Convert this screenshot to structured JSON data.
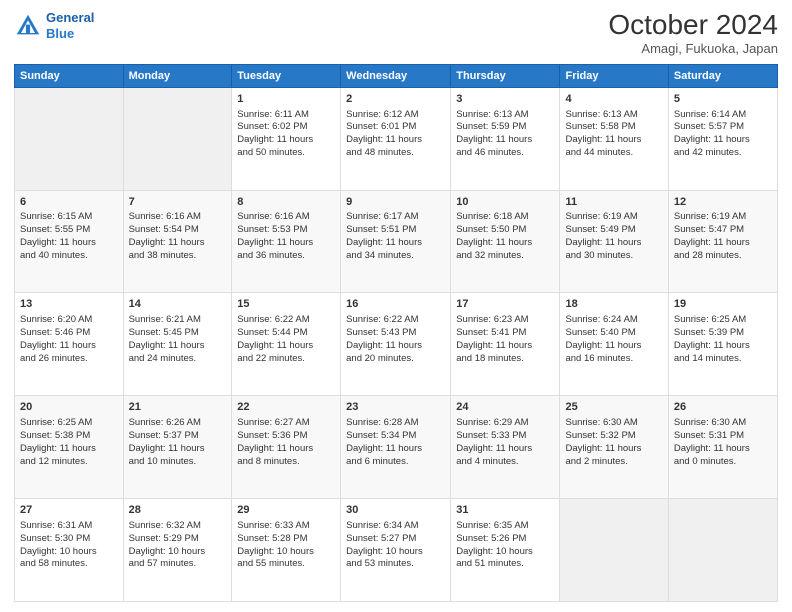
{
  "logo": {
    "line1": "General",
    "line2": "Blue"
  },
  "header": {
    "title": "October 2024",
    "subtitle": "Amagi, Fukuoka, Japan"
  },
  "days_of_week": [
    "Sunday",
    "Monday",
    "Tuesday",
    "Wednesday",
    "Thursday",
    "Friday",
    "Saturday"
  ],
  "weeks": [
    [
      {
        "day": "",
        "text": ""
      },
      {
        "day": "",
        "text": ""
      },
      {
        "day": "1",
        "text": "Sunrise: 6:11 AM\nSunset: 6:02 PM\nDaylight: 11 hours\nand 50 minutes."
      },
      {
        "day": "2",
        "text": "Sunrise: 6:12 AM\nSunset: 6:01 PM\nDaylight: 11 hours\nand 48 minutes."
      },
      {
        "day": "3",
        "text": "Sunrise: 6:13 AM\nSunset: 5:59 PM\nDaylight: 11 hours\nand 46 minutes."
      },
      {
        "day": "4",
        "text": "Sunrise: 6:13 AM\nSunset: 5:58 PM\nDaylight: 11 hours\nand 44 minutes."
      },
      {
        "day": "5",
        "text": "Sunrise: 6:14 AM\nSunset: 5:57 PM\nDaylight: 11 hours\nand 42 minutes."
      }
    ],
    [
      {
        "day": "6",
        "text": "Sunrise: 6:15 AM\nSunset: 5:55 PM\nDaylight: 11 hours\nand 40 minutes."
      },
      {
        "day": "7",
        "text": "Sunrise: 6:16 AM\nSunset: 5:54 PM\nDaylight: 11 hours\nand 38 minutes."
      },
      {
        "day": "8",
        "text": "Sunrise: 6:16 AM\nSunset: 5:53 PM\nDaylight: 11 hours\nand 36 minutes."
      },
      {
        "day": "9",
        "text": "Sunrise: 6:17 AM\nSunset: 5:51 PM\nDaylight: 11 hours\nand 34 minutes."
      },
      {
        "day": "10",
        "text": "Sunrise: 6:18 AM\nSunset: 5:50 PM\nDaylight: 11 hours\nand 32 minutes."
      },
      {
        "day": "11",
        "text": "Sunrise: 6:19 AM\nSunset: 5:49 PM\nDaylight: 11 hours\nand 30 minutes."
      },
      {
        "day": "12",
        "text": "Sunrise: 6:19 AM\nSunset: 5:47 PM\nDaylight: 11 hours\nand 28 minutes."
      }
    ],
    [
      {
        "day": "13",
        "text": "Sunrise: 6:20 AM\nSunset: 5:46 PM\nDaylight: 11 hours\nand 26 minutes."
      },
      {
        "day": "14",
        "text": "Sunrise: 6:21 AM\nSunset: 5:45 PM\nDaylight: 11 hours\nand 24 minutes."
      },
      {
        "day": "15",
        "text": "Sunrise: 6:22 AM\nSunset: 5:44 PM\nDaylight: 11 hours\nand 22 minutes."
      },
      {
        "day": "16",
        "text": "Sunrise: 6:22 AM\nSunset: 5:43 PM\nDaylight: 11 hours\nand 20 minutes."
      },
      {
        "day": "17",
        "text": "Sunrise: 6:23 AM\nSunset: 5:41 PM\nDaylight: 11 hours\nand 18 minutes."
      },
      {
        "day": "18",
        "text": "Sunrise: 6:24 AM\nSunset: 5:40 PM\nDaylight: 11 hours\nand 16 minutes."
      },
      {
        "day": "19",
        "text": "Sunrise: 6:25 AM\nSunset: 5:39 PM\nDaylight: 11 hours\nand 14 minutes."
      }
    ],
    [
      {
        "day": "20",
        "text": "Sunrise: 6:25 AM\nSunset: 5:38 PM\nDaylight: 11 hours\nand 12 minutes."
      },
      {
        "day": "21",
        "text": "Sunrise: 6:26 AM\nSunset: 5:37 PM\nDaylight: 11 hours\nand 10 minutes."
      },
      {
        "day": "22",
        "text": "Sunrise: 6:27 AM\nSunset: 5:36 PM\nDaylight: 11 hours\nand 8 minutes."
      },
      {
        "day": "23",
        "text": "Sunrise: 6:28 AM\nSunset: 5:34 PM\nDaylight: 11 hours\nand 6 minutes."
      },
      {
        "day": "24",
        "text": "Sunrise: 6:29 AM\nSunset: 5:33 PM\nDaylight: 11 hours\nand 4 minutes."
      },
      {
        "day": "25",
        "text": "Sunrise: 6:30 AM\nSunset: 5:32 PM\nDaylight: 11 hours\nand 2 minutes."
      },
      {
        "day": "26",
        "text": "Sunrise: 6:30 AM\nSunset: 5:31 PM\nDaylight: 11 hours\nand 0 minutes."
      }
    ],
    [
      {
        "day": "27",
        "text": "Sunrise: 6:31 AM\nSunset: 5:30 PM\nDaylight: 10 hours\nand 58 minutes."
      },
      {
        "day": "28",
        "text": "Sunrise: 6:32 AM\nSunset: 5:29 PM\nDaylight: 10 hours\nand 57 minutes."
      },
      {
        "day": "29",
        "text": "Sunrise: 6:33 AM\nSunset: 5:28 PM\nDaylight: 10 hours\nand 55 minutes."
      },
      {
        "day": "30",
        "text": "Sunrise: 6:34 AM\nSunset: 5:27 PM\nDaylight: 10 hours\nand 53 minutes."
      },
      {
        "day": "31",
        "text": "Sunrise: 6:35 AM\nSunset: 5:26 PM\nDaylight: 10 hours\nand 51 minutes."
      },
      {
        "day": "",
        "text": ""
      },
      {
        "day": "",
        "text": ""
      }
    ]
  ]
}
